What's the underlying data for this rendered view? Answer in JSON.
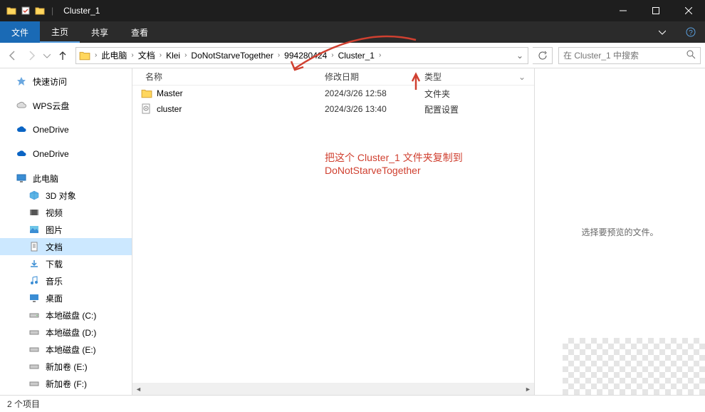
{
  "title": "Cluster_1",
  "menu": {
    "file": "文件",
    "home": "主页",
    "share": "共享",
    "view": "查看"
  },
  "breadcrumb": [
    "此电脑",
    "文档",
    "Klei",
    "DoNotStarveTogether",
    "994280424",
    "Cluster_1"
  ],
  "search": {
    "placeholder": "在 Cluster_1 中搜索"
  },
  "sidebar": {
    "quickaccess": "快速访问",
    "wps": "WPS云盘",
    "onedrive1": "OneDrive",
    "onedrive2": "OneDrive",
    "thispc": "此电脑",
    "items": [
      {
        "label": "3D 对象"
      },
      {
        "label": "视频"
      },
      {
        "label": "图片"
      },
      {
        "label": "文档"
      },
      {
        "label": "下载"
      },
      {
        "label": "音乐"
      },
      {
        "label": "桌面"
      },
      {
        "label": "本地磁盘 (C:)"
      },
      {
        "label": "本地磁盘 (D:)"
      },
      {
        "label": "本地磁盘 (E:)"
      },
      {
        "label": "新加卷 (E:)"
      },
      {
        "label": "新加卷 (F:)"
      }
    ]
  },
  "columns": {
    "name": "名称",
    "date": "修改日期",
    "type": "类型"
  },
  "files": [
    {
      "name": "Master",
      "date": "2024/3/26 12:58",
      "type": "文件夹",
      "icon": "folder"
    },
    {
      "name": "cluster",
      "date": "2024/3/26 13:40",
      "type": "配置设置",
      "icon": "settings"
    }
  ],
  "annotation": "把这个 Cluster_1 文件夹复制到 DoNotStarveTogether",
  "preview": "选择要预览的文件。",
  "status": "2 个项目"
}
